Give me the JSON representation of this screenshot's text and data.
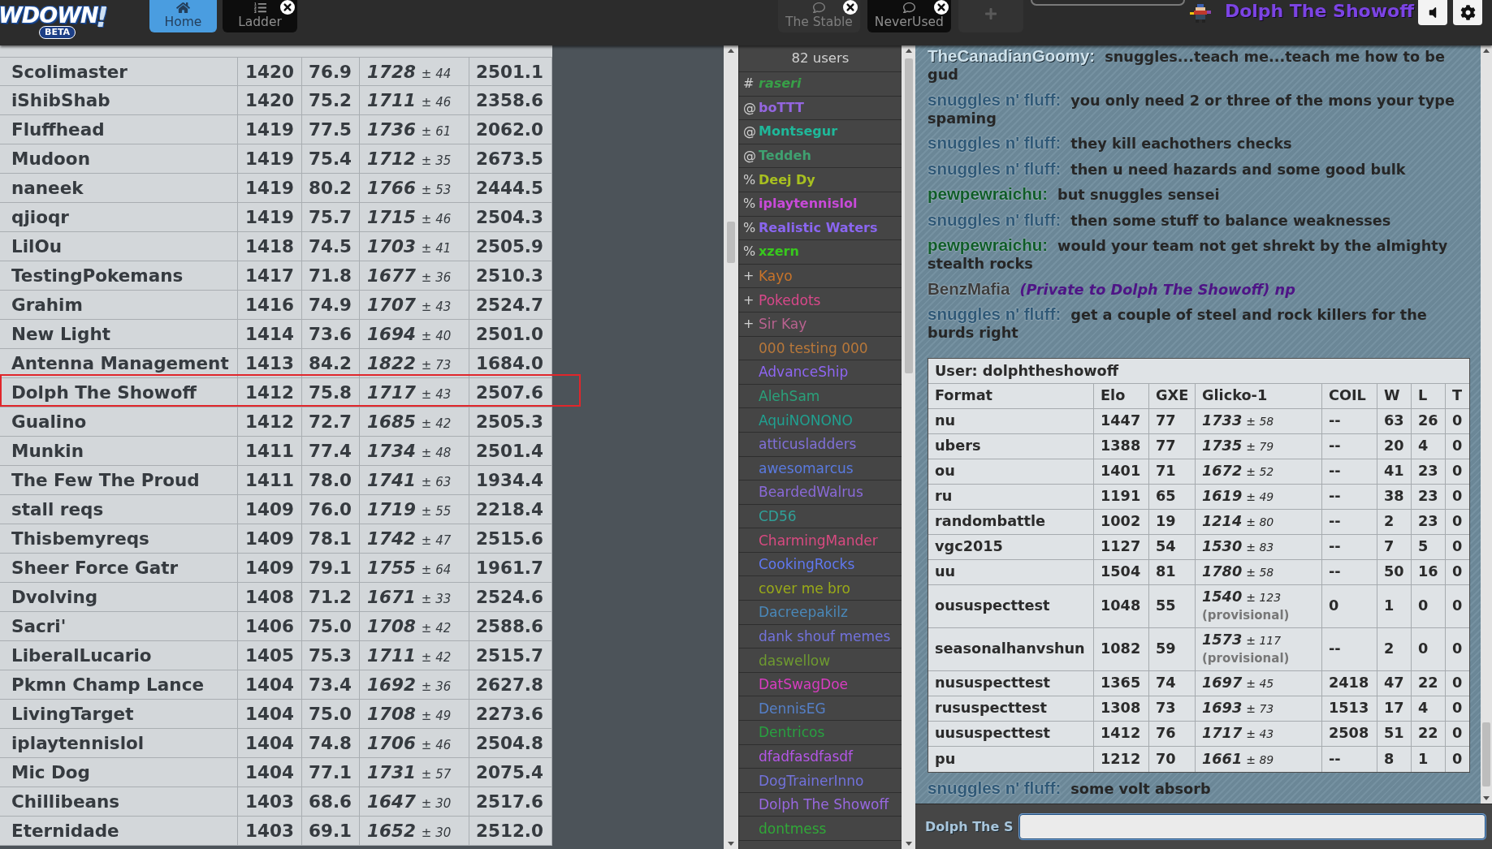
{
  "header": {
    "logo": {
      "wordmark": "WDOWN",
      "mark": "!",
      "badge": "BETA"
    },
    "left_tabs": [
      {
        "label": "Home",
        "kind": "home",
        "selected": false,
        "closable": false
      },
      {
        "label": "Ladder",
        "kind": "ladder",
        "selected": true,
        "closable": true
      }
    ],
    "right_tabs": [
      {
        "label": "The Stable",
        "kind": "chat",
        "selected": false,
        "closable": true
      },
      {
        "label": "NeverUsed",
        "kind": "chat",
        "selected": true,
        "closable": true
      }
    ],
    "username": "Dolph The Showoff"
  },
  "ladder": {
    "rows": [
      {
        "column_1": "Scolimaster",
        "column_2": "1420",
        "column_3": "76.9",
        "column_4": {
          "value": "1728",
          "spread": "± 44"
        },
        "column_5": "2501.1",
        "highlighted": false
      },
      {
        "column_1": "iShibShab",
        "column_2": "1420",
        "column_3": "75.2",
        "column_4": {
          "value": "1711",
          "spread": "± 46"
        },
        "column_5": "2358.6",
        "highlighted": false
      },
      {
        "column_1": "Fluffhead",
        "column_2": "1419",
        "column_3": "77.5",
        "column_4": {
          "value": "1736",
          "spread": "± 61"
        },
        "column_5": "2062.0",
        "highlighted": false
      },
      {
        "column_1": "Mudoon",
        "column_2": "1419",
        "column_3": "75.4",
        "column_4": {
          "value": "1712",
          "spread": "± 35"
        },
        "column_5": "2673.5",
        "highlighted": false
      },
      {
        "column_1": "naneek",
        "column_2": "1419",
        "column_3": "80.2",
        "column_4": {
          "value": "1766",
          "spread": "± 53"
        },
        "column_5": "2444.5",
        "highlighted": false
      },
      {
        "column_1": "qjioqr",
        "column_2": "1419",
        "column_3": "75.7",
        "column_4": {
          "value": "1715",
          "spread": "± 46"
        },
        "column_5": "2504.3",
        "highlighted": false
      },
      {
        "column_1": "LilOu",
        "column_2": "1418",
        "column_3": "74.5",
        "column_4": {
          "value": "1703",
          "spread": "± 41"
        },
        "column_5": "2505.9",
        "highlighted": false
      },
      {
        "column_1": "TestingPokemans",
        "column_2": "1417",
        "column_3": "71.8",
        "column_4": {
          "value": "1677",
          "spread": "± 36"
        },
        "column_5": "2510.3",
        "highlighted": false
      },
      {
        "column_1": "Grahim",
        "column_2": "1416",
        "column_3": "74.9",
        "column_4": {
          "value": "1707",
          "spread": "± 43"
        },
        "column_5": "2524.7",
        "highlighted": false
      },
      {
        "column_1": "New Light",
        "column_2": "1414",
        "column_3": "73.6",
        "column_4": {
          "value": "1694",
          "spread": "± 40"
        },
        "column_5": "2501.0",
        "highlighted": false
      },
      {
        "column_1": "Antenna Management",
        "column_2": "1413",
        "column_3": "84.2",
        "column_4": {
          "value": "1822",
          "spread": "± 73"
        },
        "column_5": "1684.0",
        "highlighted": false
      },
      {
        "column_1": "Dolph The Showoff",
        "column_2": "1412",
        "column_3": "75.8",
        "column_4": {
          "value": "1717",
          "spread": "± 43"
        },
        "column_5": "2507.6",
        "highlighted": true
      },
      {
        "column_1": "Gualino",
        "column_2": "1412",
        "column_3": "72.7",
        "column_4": {
          "value": "1685",
          "spread": "± 42"
        },
        "column_5": "2505.3",
        "highlighted": false
      },
      {
        "column_1": "Munkin",
        "column_2": "1411",
        "column_3": "77.4",
        "column_4": {
          "value": "1734",
          "spread": "± 48"
        },
        "column_5": "2501.4",
        "highlighted": false
      },
      {
        "column_1": "The Few The Proud",
        "column_2": "1411",
        "column_3": "78.0",
        "column_4": {
          "value": "1741",
          "spread": "± 63"
        },
        "column_5": "1934.4",
        "highlighted": false
      },
      {
        "column_1": "stall reqs",
        "column_2": "1409",
        "column_3": "76.0",
        "column_4": {
          "value": "1719",
          "spread": "± 55"
        },
        "column_5": "2218.4",
        "highlighted": false
      },
      {
        "column_1": "Thisbemyreqs",
        "column_2": "1409",
        "column_3": "78.1",
        "column_4": {
          "value": "1742",
          "spread": "± 47"
        },
        "column_5": "2515.6",
        "highlighted": false
      },
      {
        "column_1": "Sheer Force Gatr",
        "column_2": "1409",
        "column_3": "79.1",
        "column_4": {
          "value": "1755",
          "spread": "± 64"
        },
        "column_5": "1961.7",
        "highlighted": false
      },
      {
        "column_1": "Dvolving",
        "column_2": "1408",
        "column_3": "71.2",
        "column_4": {
          "value": "1671",
          "spread": "± 33"
        },
        "column_5": "2524.6",
        "highlighted": false
      },
      {
        "column_1": "Sacri'",
        "column_2": "1406",
        "column_3": "75.0",
        "column_4": {
          "value": "1708",
          "spread": "± 42"
        },
        "column_5": "2588.6",
        "highlighted": false
      },
      {
        "column_1": "LiberalLucario",
        "column_2": "1405",
        "column_3": "75.3",
        "column_4": {
          "value": "1711",
          "spread": "± 42"
        },
        "column_5": "2515.7",
        "highlighted": false
      },
      {
        "column_1": "Pkmn Champ Lance",
        "column_2": "1404",
        "column_3": "73.4",
        "column_4": {
          "value": "1692",
          "spread": "± 36"
        },
        "column_5": "2627.8",
        "highlighted": false
      },
      {
        "column_1": "LivingTarget",
        "column_2": "1404",
        "column_3": "75.0",
        "column_4": {
          "value": "1708",
          "spread": "± 49"
        },
        "column_5": "2273.6",
        "highlighted": false
      },
      {
        "column_1": "iplaytennislol",
        "column_2": "1404",
        "column_3": "74.8",
        "column_4": {
          "value": "1706",
          "spread": "± 46"
        },
        "column_5": "2504.8",
        "highlighted": false
      },
      {
        "column_1": "Mic Dog",
        "column_2": "1404",
        "column_3": "77.1",
        "column_4": {
          "value": "1731",
          "spread": "± 57"
        },
        "column_5": "2075.4",
        "highlighted": false
      },
      {
        "column_1": "Chillibeans",
        "column_2": "1403",
        "column_3": "68.6",
        "column_4": {
          "value": "1647",
          "spread": "± 30"
        },
        "column_5": "2517.6",
        "highlighted": false
      },
      {
        "column_1": "Eternidade",
        "column_2": "1403",
        "column_3": "69.1",
        "column_4": {
          "value": "1652",
          "spread": "± 30"
        },
        "column_5": "2512.0",
        "highlighted": false
      }
    ]
  },
  "user_list": {
    "count_label": "82 users",
    "users": [
      {
        "rank": "#",
        "name": "raseri",
        "kind": "owner",
        "color": "#38a048"
      },
      {
        "rank": "@",
        "name": "boTTT",
        "kind": "staff",
        "color": "#9466e0"
      },
      {
        "rank": "@",
        "name": "Montsegur",
        "kind": "staff",
        "color": "#1fb89a"
      },
      {
        "rank": "@",
        "name": "Teddeh",
        "kind": "staff",
        "color": "#3fa070"
      },
      {
        "rank": "%",
        "name": "Deej Dy",
        "kind": "staff",
        "color": "#a8c020"
      },
      {
        "rank": "%",
        "name": "iplaytennislol",
        "kind": "staff",
        "color": "#c84ad8"
      },
      {
        "rank": "%",
        "name": "Realistic Waters",
        "kind": "staff",
        "color": "#8a66f0"
      },
      {
        "rank": "%",
        "name": "xzern",
        "kind": "staff",
        "color": "#38c81e"
      },
      {
        "rank": "+",
        "name": "Kayo",
        "kind": "voiced",
        "color": "#c8742a"
      },
      {
        "rank": "+",
        "name": "Pokedots",
        "kind": "voiced",
        "color": "#d8488a"
      },
      {
        "rank": "+",
        "name": "Sir Kay",
        "kind": "voiced",
        "color": "#b8628f"
      },
      {
        "name": "000 testing 000",
        "kind": "regular",
        "color": "#b8783a"
      },
      {
        "name": "AdvanceShip",
        "kind": "regular",
        "color": "#8e66f2"
      },
      {
        "name": "AlehSam",
        "kind": "regular",
        "color": "#2aa07a"
      },
      {
        "name": "AquiNONONO",
        "kind": "regular",
        "color": "#20a090"
      },
      {
        "name": "atticusladders",
        "kind": "regular",
        "color": "#8070d8"
      },
      {
        "name": "awesomarcus",
        "kind": "regular",
        "color": "#5a7ae0"
      },
      {
        "name": "BeardedWalrus",
        "kind": "regular",
        "color": "#8a6ad8"
      },
      {
        "name": "CD56",
        "kind": "regular",
        "color": "#30a098"
      },
      {
        "name": "CharmingMander",
        "kind": "regular",
        "color": "#d84a80"
      },
      {
        "name": "CookingRocks",
        "kind": "regular",
        "color": "#6078f0"
      },
      {
        "name": "cover me bro",
        "kind": "regular",
        "color": "#9aaa18"
      },
      {
        "name": "Dacreepakilz",
        "kind": "regular",
        "color": "#4a88b8"
      },
      {
        "name": "dank shouf memes",
        "kind": "regular",
        "color": "#7272dc"
      },
      {
        "name": "daswellow",
        "kind": "regular",
        "color": "#6e9a30"
      },
      {
        "name": "DatSwagDoe",
        "kind": "regular",
        "color": "#d83cc0"
      },
      {
        "name": "DennisEG",
        "kind": "regular",
        "color": "#5580c8"
      },
      {
        "name": "Dentricos",
        "kind": "regular",
        "color": "#28a040"
      },
      {
        "name": "dfadfasdfasdf",
        "kind": "regular",
        "color": "#b456e6"
      },
      {
        "name": "DogTrainerInno",
        "kind": "regular",
        "color": "#7272dc"
      },
      {
        "name": "Dolph The Showoff",
        "kind": "regular",
        "color": "#9868e0"
      },
      {
        "name": "dontmess",
        "kind": "regular",
        "color": "#30a838"
      }
    ]
  },
  "chat": {
    "log": [
      {
        "kind": "chat",
        "user": "TheCanadianGoomy:",
        "color": "#cfe2ec",
        "text": "snuggles...teach me...teach me how to be gud"
      },
      {
        "kind": "chat",
        "user": "snuggles n' fluff:",
        "color": "#2f5876",
        "text": "you only need 2 or three of the mons your type spaming"
      },
      {
        "kind": "chat",
        "user": "snuggles n' fluff:",
        "color": "#2f5876",
        "text": "they kill eachothers checks"
      },
      {
        "kind": "chat",
        "user": "snuggles n' fluff:",
        "color": "#2f5876",
        "text": "then u need hazards and some good bulk"
      },
      {
        "kind": "chat",
        "user": "pewpewraichu:",
        "color": "#0f5c28",
        "text": "but snuggles sensei"
      },
      {
        "kind": "chat",
        "user": "snuggles n' fluff:",
        "color": "#2f5876",
        "text": "then some stuff to balance weaknesses"
      },
      {
        "kind": "chat",
        "user": "pewpewraichu:",
        "color": "#0f5c28",
        "text": "would your team not get shrekt by the almighty stealth rocks"
      },
      {
        "kind": "private",
        "user": "BenzMafia",
        "color": "#3c3c3c",
        "text": "(Private to Dolph The Showoff) np"
      },
      {
        "kind": "chat",
        "user": "snuggles n' fluff:",
        "color": "#2f5876",
        "text": "get a couple of steel and rock killers for the burds right"
      },
      {
        "kind": "rating_card",
        "title": "User: dolphtheshowoff",
        "columns": [
          "Format",
          "Elo",
          "GXE",
          "Glicko-1",
          "COIL",
          "W",
          "L",
          "T"
        ],
        "rows": [
          {
            "format": "nu",
            "elo": "1447",
            "gxe": "77",
            "glicko": {
              "value": "1733",
              "spread": "± 58"
            },
            "coil": "--",
            "w": "63",
            "l": "26",
            "t": "0"
          },
          {
            "format": "ubers",
            "elo": "1388",
            "gxe": "77",
            "glicko": {
              "value": "1735",
              "spread": "± 79"
            },
            "coil": "--",
            "w": "20",
            "l": "4",
            "t": "0"
          },
          {
            "format": "ou",
            "elo": "1401",
            "gxe": "71",
            "glicko": {
              "value": "1672",
              "spread": "± 52"
            },
            "coil": "--",
            "w": "41",
            "l": "23",
            "t": "0"
          },
          {
            "format": "ru",
            "elo": "1191",
            "gxe": "65",
            "glicko": {
              "value": "1619",
              "spread": "± 49"
            },
            "coil": "--",
            "w": "38",
            "l": "23",
            "t": "0"
          },
          {
            "format": "randombattle",
            "elo": "1002",
            "gxe": "19",
            "glicko": {
              "value": "1214",
              "spread": "± 80"
            },
            "coil": "--",
            "w": "2",
            "l": "23",
            "t": "0"
          },
          {
            "format": "vgc2015",
            "elo": "1127",
            "gxe": "54",
            "glicko": {
              "value": "1530",
              "spread": "± 83"
            },
            "coil": "--",
            "w": "7",
            "l": "5",
            "t": "0"
          },
          {
            "format": "uu",
            "elo": "1504",
            "gxe": "81",
            "glicko": {
              "value": "1780",
              "spread": "± 58"
            },
            "coil": "--",
            "w": "50",
            "l": "16",
            "t": "0"
          },
          {
            "format": "oususpecttest",
            "elo": "1048",
            "gxe": "55",
            "glicko": {
              "value": "1540",
              "spread": "± 123",
              "note": "(provisional)"
            },
            "coil": "0",
            "w": "1",
            "l": "0",
            "t": "0"
          },
          {
            "format": "seasonalhanvshun",
            "elo": "1082",
            "gxe": "59",
            "glicko": {
              "value": "1573",
              "spread": "± 117",
              "note": "(provisional)"
            },
            "coil": "--",
            "w": "2",
            "l": "0",
            "t": "0"
          },
          {
            "format": "nususpecttest",
            "elo": "1365",
            "gxe": "74",
            "glicko": {
              "value": "1697",
              "spread": "± 45"
            },
            "coil": "2418",
            "w": "47",
            "l": "22",
            "t": "0"
          },
          {
            "format": "rususpecttest",
            "elo": "1308",
            "gxe": "73",
            "glicko": {
              "value": "1693",
              "spread": "± 73"
            },
            "coil": "1513",
            "w": "17",
            "l": "4",
            "t": "0"
          },
          {
            "format": "uususpecttest",
            "elo": "1412",
            "gxe": "76",
            "glicko": {
              "value": "1717",
              "spread": "± 43"
            },
            "coil": "2508",
            "w": "51",
            "l": "22",
            "t": "0"
          },
          {
            "format": "pu",
            "elo": "1212",
            "gxe": "70",
            "glicko": {
              "value": "1661",
              "spread": "± 89"
            },
            "coil": "--",
            "w": "8",
            "l": "1",
            "t": "0"
          }
        ]
      },
      {
        "kind": "chat",
        "user": "snuggles n' fluff:",
        "color": "#2f5876",
        "text": "some volt absorb"
      }
    ],
    "input": {
      "label": "Dolph The S"
    }
  }
}
